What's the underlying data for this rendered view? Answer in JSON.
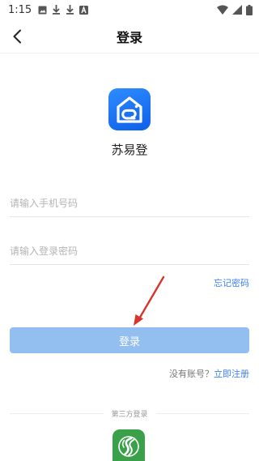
{
  "status_bar": {
    "time": "1:15",
    "left_icons": [
      "image-icon",
      "download-icon",
      "download-icon",
      "font-icon"
    ],
    "right_icons": [
      "wifi-icon",
      "signal-icon",
      "battery-icon"
    ]
  },
  "nav": {
    "title": "登录",
    "back_icon": "chevron-left-icon"
  },
  "app": {
    "name": "苏易登",
    "logo_icon": "house-logo-icon",
    "logo_color": "#1a6ff0"
  },
  "form": {
    "phone_placeholder": "请输入手机号码",
    "phone_value": "",
    "password_placeholder": "请输入登录密码",
    "password_value": "",
    "forgot_label": "忘记密码",
    "login_label": "登录",
    "login_color": "#93bff0",
    "no_account_label": "没有账号？",
    "register_label": "立即注册",
    "link_color": "#3d7ff0"
  },
  "third_party": {
    "label": "第三方登录",
    "icon": "third-party-login-icon",
    "icon_color": "#3aa04a"
  },
  "annotation": {
    "arrow_color": "#d9342b"
  }
}
